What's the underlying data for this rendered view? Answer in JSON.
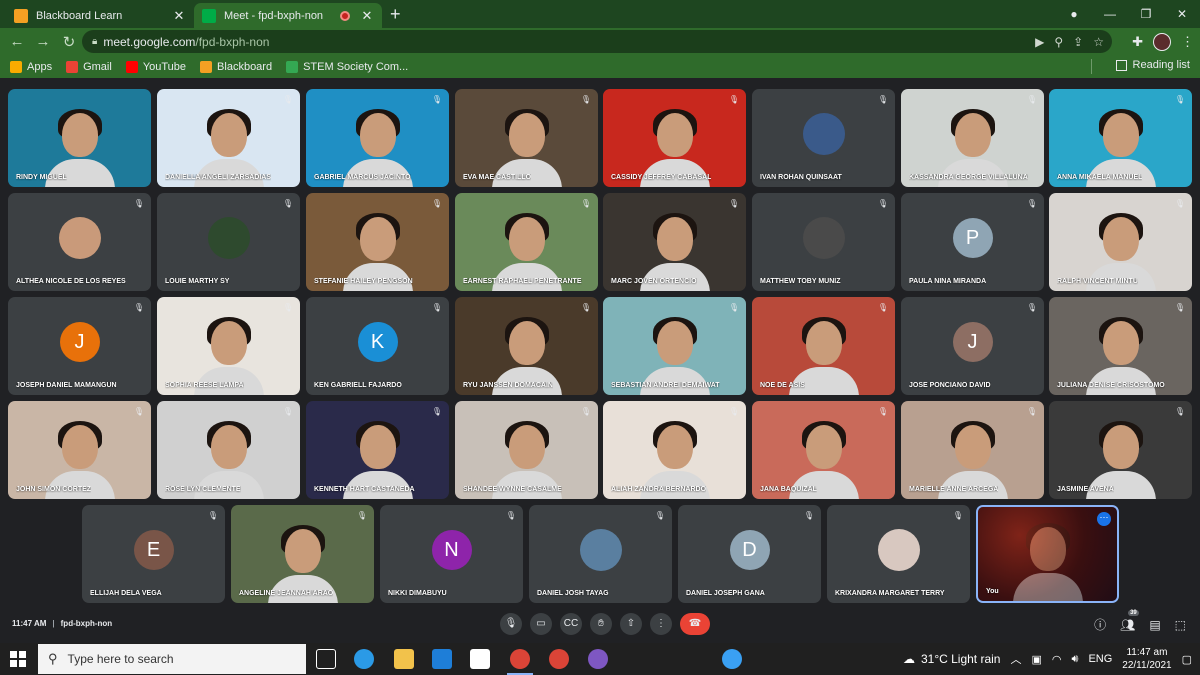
{
  "browser": {
    "tabs": [
      {
        "title": "Blackboard Learn",
        "favicon_color": "#f4a023",
        "active": false
      },
      {
        "title": "Meet - fpd-bxph-non",
        "favicon_color": "#00ac47",
        "active": true
      }
    ],
    "url_host": "meet.google.com",
    "url_path": "/fpd-bxph-non",
    "bookmarks": [
      {
        "label": "Apps",
        "icon": "apps-grid-icon",
        "color": "#f9ab00"
      },
      {
        "label": "Gmail",
        "icon": "gmail-icon",
        "color": "#ea4335"
      },
      {
        "label": "YouTube",
        "icon": "youtube-icon",
        "color": "#ff0000"
      },
      {
        "label": "Blackboard",
        "icon": "blackboard-icon",
        "color": "#f4a023"
      },
      {
        "label": "STEM Society Com...",
        "icon": "google-drive-icon",
        "color": "#34a853"
      }
    ],
    "reading_list": "Reading list"
  },
  "meet": {
    "participants": [
      {
        "name": "RINDY MIGUEL",
        "kind": "video",
        "bg": "#1e7a9a"
      },
      {
        "name": "DANIELLA ANGELI ZARSADIAS",
        "kind": "video",
        "bg": "#d9e6f2"
      },
      {
        "name": "GABRIEL MARCUS JACINTO",
        "kind": "video",
        "bg": "#1f8fc4"
      },
      {
        "name": "EVA MAE CASTILLO",
        "kind": "video",
        "bg": "#5a4a3a"
      },
      {
        "name": "CASSIDY JEFFREY CABASAL",
        "kind": "video",
        "bg": "#c8281e"
      },
      {
        "name": "IVAN ROHAN QUINSAAT",
        "kind": "thumb",
        "bg": "#3c4043",
        "thumb": "#3a5a8a"
      },
      {
        "name": "KASSANDRA GEORGE VILLALUNA",
        "kind": "video",
        "bg": "#cfd3d0"
      },
      {
        "name": "ANNA MIKAELA MANUEL",
        "kind": "video",
        "bg": "#2aa6c9"
      },
      {
        "name": "ALTHEA NICOLE DE LOS REYES",
        "kind": "thumb",
        "bg": "#3c4043",
        "thumb": "#c99a7a"
      },
      {
        "name": "LOUIE MARTHY SY",
        "kind": "thumb",
        "bg": "#3c4043",
        "thumb": "#2e4a2e"
      },
      {
        "name": "STEFANIE HAILEY PENGSON",
        "kind": "video",
        "bg": "#7a5a3a"
      },
      {
        "name": "EARNEST RAPHAEL PENETRANTE",
        "kind": "video",
        "bg": "#6a8a5a"
      },
      {
        "name": "MARC JOVEN ORTENCIO",
        "kind": "video",
        "bg": "#3a3530"
      },
      {
        "name": "MATTHEW TOBY MUNIZ",
        "kind": "thumb",
        "bg": "#3c4043",
        "thumb": "#4a4a4a"
      },
      {
        "name": "PAULA NINA MIRANDA",
        "kind": "letter",
        "bg": "#3c4043",
        "letter": "P",
        "color": "#8fa5b4"
      },
      {
        "name": "RALPH VINCENT MINTU",
        "kind": "video",
        "bg": "#d8d4d0"
      },
      {
        "name": "JOSEPH DANIEL MAMANGUN",
        "kind": "letter",
        "bg": "#3c4043",
        "letter": "J",
        "color": "#e8710a"
      },
      {
        "name": "SOPHIA REESE LAMPA",
        "kind": "video",
        "bg": "#e8e4de"
      },
      {
        "name": "KEN GABRIELL FAJARDO",
        "kind": "letter",
        "bg": "#3c4043",
        "letter": "K",
        "color": "#1a8fd6"
      },
      {
        "name": "RYU JANSSEN DOMACAIN",
        "kind": "video",
        "bg": "#4a3a2a"
      },
      {
        "name": "SEBASTIAN ANDREI DEMAIWAT",
        "kind": "video",
        "bg": "#7fb3b8"
      },
      {
        "name": "NOE DE ASIS",
        "kind": "video",
        "bg": "#b84a3a"
      },
      {
        "name": "JOSE PONCIANO DAVID",
        "kind": "letter",
        "bg": "#3c4043",
        "letter": "J",
        "color": "#8d6e63"
      },
      {
        "name": "JULIANA DENISE CRISOSTOMO",
        "kind": "video",
        "bg": "#6a6560"
      },
      {
        "name": "JOHN SIMON CORTEZ",
        "kind": "video",
        "bg": "#c9b6a6"
      },
      {
        "name": "ROSE LYN CLEMENTE",
        "kind": "video",
        "bg": "#d0d0d0"
      },
      {
        "name": "KENNETH HART CASTANEDA",
        "kind": "video",
        "bg": "#2a2a4a"
      },
      {
        "name": "SHANDEE WYNNE CASALME",
        "kind": "video",
        "bg": "#c8c0b8"
      },
      {
        "name": "ALIAH ZANDRA BERNARDO",
        "kind": "video",
        "bg": "#e8e0d8"
      },
      {
        "name": "JANA BAQUIZAL",
        "kind": "video",
        "bg": "#c96a5a"
      },
      {
        "name": "MARIELLE ANNE ARCEGA",
        "kind": "video",
        "bg": "#b8a090"
      },
      {
        "name": "JASMINE AVENA",
        "kind": "video",
        "bg": "#3a3a3a"
      },
      {
        "name": "ELLIJAH DELA VEGA",
        "kind": "letter",
        "bg": "#3c4043",
        "letter": "E",
        "color": "#795548"
      },
      {
        "name": "ANGELINE JEANNAH ARAO",
        "kind": "video",
        "bg": "#5a6a4a"
      },
      {
        "name": "NIKKI DIMABUYU",
        "kind": "letter",
        "bg": "#3c4043",
        "letter": "N",
        "color": "#8e24aa"
      },
      {
        "name": "DANIEL JOSH TAYAG",
        "kind": "thumb",
        "bg": "#3c4043",
        "thumb": "#5a7fa0"
      },
      {
        "name": "DANIEL JOSEPH GANA",
        "kind": "letter",
        "bg": "#3c4043",
        "letter": "D",
        "color": "#8fa5b4"
      },
      {
        "name": "KRIXANDRA MARGARET TERRY",
        "kind": "thumb",
        "bg": "#3c4043",
        "thumb": "#d8c8c0"
      },
      {
        "name": "You",
        "kind": "self",
        "bg": "#3a0f10"
      }
    ],
    "time": "11:47 AM",
    "meeting_code": "fpd-bxph-non",
    "participant_count": "39"
  },
  "taskbar": {
    "search_placeholder": "Type here to search",
    "weather": "31°C  Light rain",
    "language": "ENG",
    "time": "11:47 am",
    "date": "22/11/2021"
  }
}
